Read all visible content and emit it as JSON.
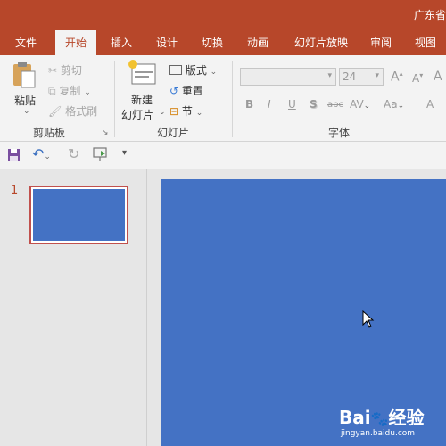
{
  "window": {
    "title": "广东省"
  },
  "tabs": [
    {
      "label": "文件",
      "active": false
    },
    {
      "label": "开始",
      "active": true
    },
    {
      "label": "插入",
      "active": false
    },
    {
      "label": "设计",
      "active": false
    },
    {
      "label": "切换",
      "active": false
    },
    {
      "label": "动画",
      "active": false
    },
    {
      "label": "幻灯片放映",
      "active": false
    },
    {
      "label": "审阅",
      "active": false
    },
    {
      "label": "视图",
      "active": false
    }
  ],
  "ribbon": {
    "clipboard": {
      "paste": "粘贴",
      "cut": "剪切",
      "copy": "复制",
      "format_painter": "格式刷",
      "group_label": "剪贴板"
    },
    "slides": {
      "new_slide_line1": "新建",
      "new_slide_line2": "幻灯片",
      "layout": "版式",
      "reset": "重置",
      "section": "节",
      "group_label": "幻灯片"
    },
    "font": {
      "font_name": "",
      "font_size": "24",
      "grow": "A",
      "shrink": "A",
      "clear": "A",
      "bold": "B",
      "italic": "I",
      "underline": "U",
      "shadow": "S",
      "strike": "abc",
      "spacing": "AV",
      "case": "Aa",
      "color": "A",
      "group_label": "字体"
    }
  },
  "slides_pane": {
    "slide_number": "1"
  },
  "watermark": {
    "brand": "Bai",
    "brand2": "经验",
    "url": "jingyan.baidu.com"
  },
  "colors": {
    "accent": "#b7472a",
    "slide_bg": "#4472c4"
  }
}
